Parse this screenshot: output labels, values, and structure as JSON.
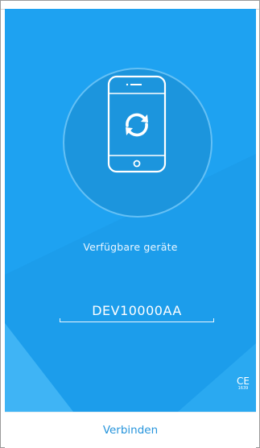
{
  "screen": {
    "available_devices_label": "Verfügbare geräte",
    "device_name": "DEV10000AA",
    "certification_mark": "CE",
    "certification_code": "1639"
  },
  "footer": {
    "connect_label": "Verbinden"
  },
  "icons": {
    "hero": "phone-sync-icon"
  },
  "colors": {
    "background": "#1fa0ee",
    "accent": "#2795dc"
  }
}
